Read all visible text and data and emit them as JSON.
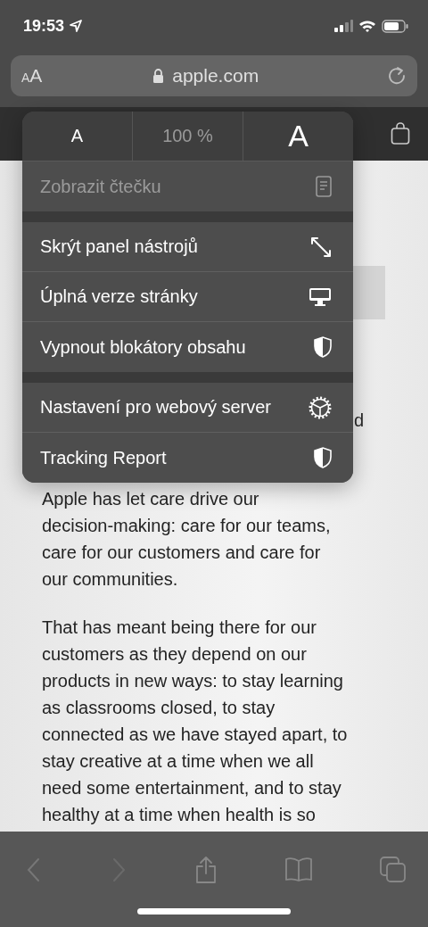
{
  "status_bar": {
    "time": "19:53"
  },
  "address_bar": {
    "text_size_button": {
      "small": "A",
      "large": "A"
    },
    "url": "apple.com"
  },
  "menu": {
    "zoom": {
      "decrease": "A",
      "level": "100 %",
      "increase": "A"
    },
    "groups": [
      [
        {
          "label": "Zobrazit čtečku",
          "kind": "reader",
          "disabled": true
        }
      ],
      [
        {
          "label": "Skrýt panel nástrojů",
          "kind": "resize",
          "disabled": false
        },
        {
          "label": "Úplná verze stránky",
          "kind": "desktop",
          "disabled": false
        },
        {
          "label": "Vypnout blokátory obsahu",
          "kind": "shield",
          "disabled": false
        }
      ],
      [
        {
          "label": "Nastavení pro webový server",
          "kind": "gear",
          "disabled": false
        },
        {
          "label": "Tracking Report",
          "kind": "shield",
          "disabled": false
        }
      ]
    ]
  },
  "page": {
    "fragment": "d",
    "paragraphs": [
      [
        "Apple has let care drive our",
        "decision-making: care for our teams,",
        "care for our customers and care for",
        "our communities."
      ],
      [
        "That has meant being there for our",
        "customers as they depend on our",
        "products in new ways: to stay learning",
        "as classrooms closed, to stay",
        "connected as we have stayed apart, to",
        "stay creative at a time when we all",
        "need some entertainment, and to stay",
        "healthy at a time when health is so"
      ]
    ]
  }
}
